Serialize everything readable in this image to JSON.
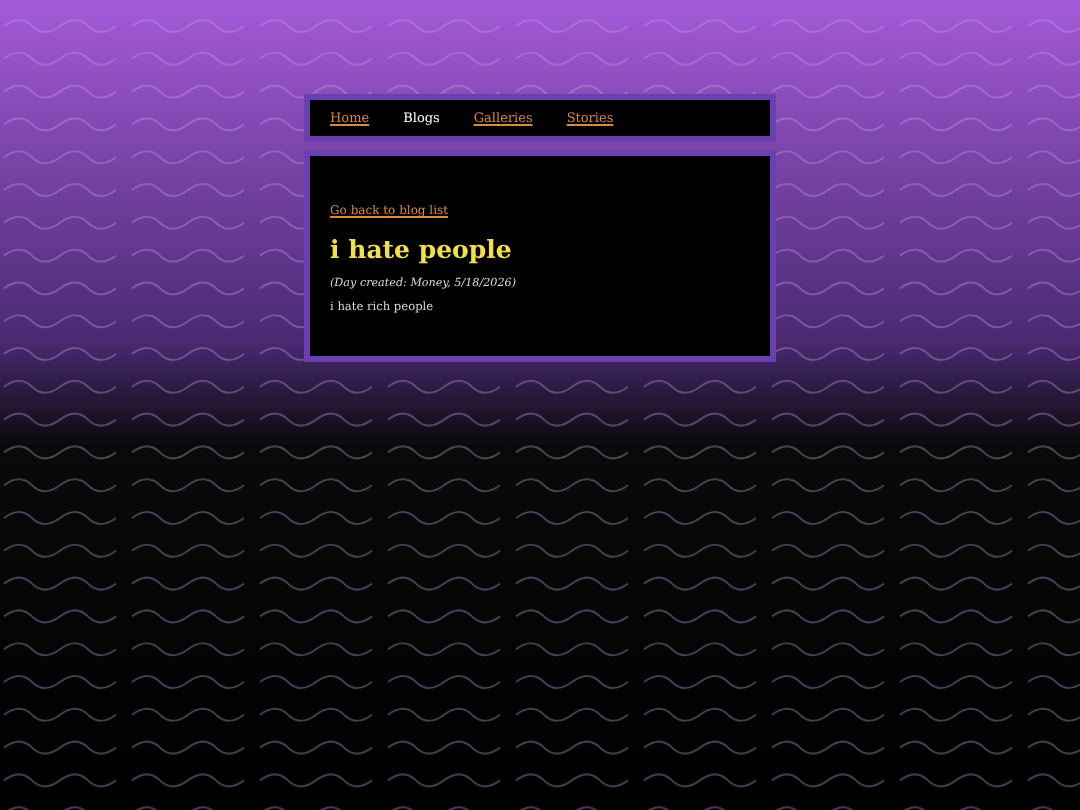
{
  "nav": [
    {
      "label": "Home",
      "selected": false
    },
    {
      "label": "Blogs",
      "selected": true
    },
    {
      "label": "Galleries",
      "selected": false
    },
    {
      "label": "Stories",
      "selected": false
    }
  ],
  "post": {
    "back_link": "Go back to blog list",
    "title": "i hate people",
    "date": "(Day created: Money, 5/18/2026)",
    "body": "i hate rich people"
  }
}
